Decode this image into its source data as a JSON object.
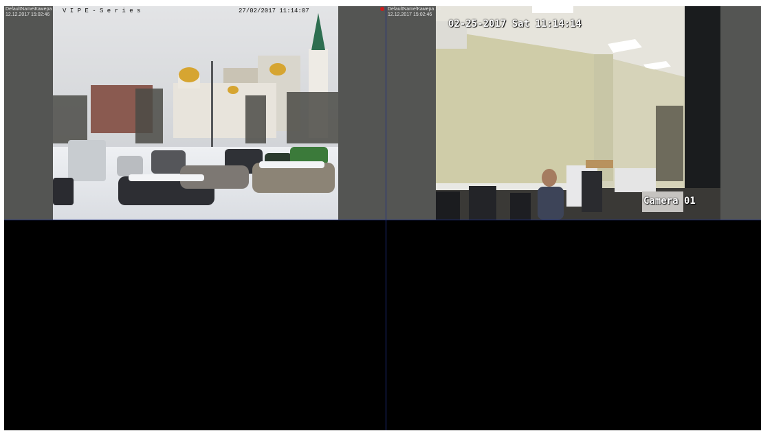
{
  "cameras": [
    {
      "name": "DefaultName\\Камера 12",
      "timestamp": "12.12.2017 15:02:46",
      "overlay_model": "V  I P  E - S e r i e s",
      "overlay_datetime": "27/02/2017 11:14:07",
      "recording": false
    },
    {
      "name": "DefaultName\\Камера 14",
      "timestamp": "12.12.2017 15:02:46",
      "overlay_datetime": "02-25-2017 Sat 11:14:14",
      "overlay_camera": "Camera 01",
      "recording": true,
      "recording_color": "#cc1b1b"
    },
    {
      "empty": true
    },
    {
      "empty": true
    }
  ],
  "colors": {
    "tile_background": "#545553",
    "empty_tile": "#000000",
    "divider": "#1f2f84"
  }
}
